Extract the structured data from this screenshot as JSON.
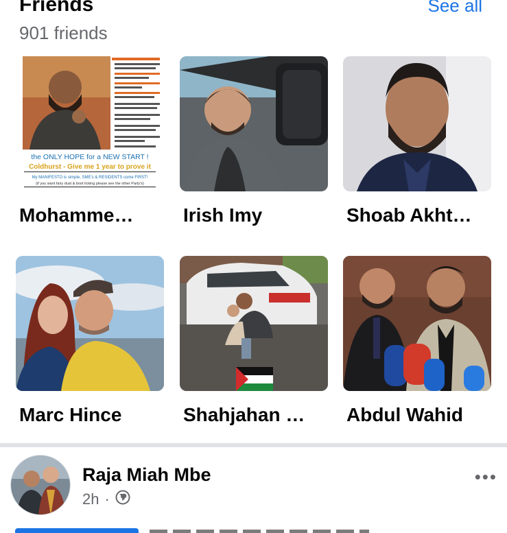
{
  "section": {
    "title": "Friends",
    "see_all": "See all",
    "count": "901 friends"
  },
  "friends": [
    {
      "name": "Mohamme…",
      "poster_line1": "the ONLY HOPE for a NEW START !",
      "poster_line2": "Coldhurst - Give me 1 year to prove it",
      "poster_line3": "My MANIFESTO is simple, SME's & RESIDENTS come FIRST!",
      "poster_line4": "(if you want fairy dust & boot licking please see the other Party's)"
    },
    {
      "name": "Irish Imy"
    },
    {
      "name": "Shoab Akht…"
    },
    {
      "name": "Marc Hince"
    },
    {
      "name": "Shahjahan …"
    },
    {
      "name": "Abdul Wahid"
    }
  ],
  "post": {
    "author": "Raja Miah Mbe",
    "time": "2h",
    "separator": "·",
    "privacy_icon": "globe-icon",
    "more_icon": "more-icon",
    "more_glyph": "•••"
  },
  "colors": {
    "link_blue": "#1b74e4",
    "secondary_text": "#65676b",
    "divider": "#dfe1e5"
  }
}
